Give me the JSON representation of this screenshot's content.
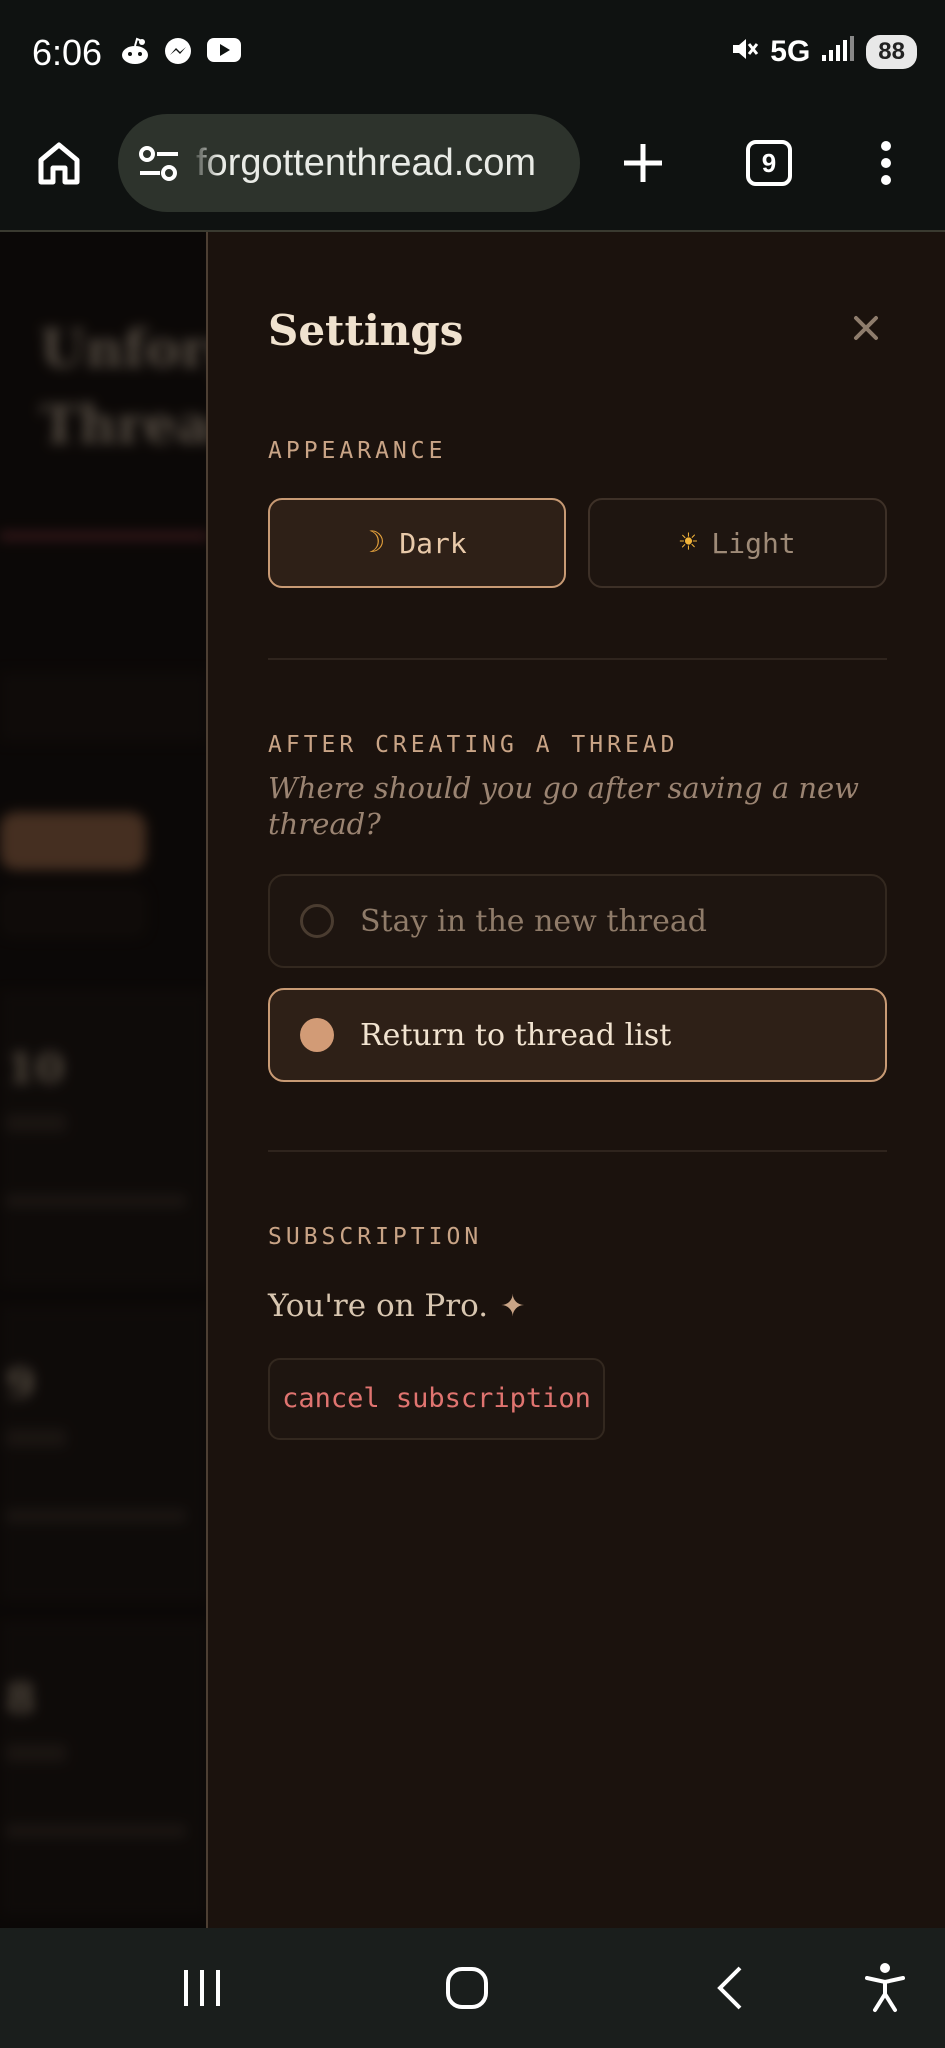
{
  "status_bar": {
    "time": "6:06",
    "network": "5G",
    "battery": "88"
  },
  "browser": {
    "url": "forgottenthread.com",
    "tab_count": "9"
  },
  "background_page": {
    "title_line1": "Unforg",
    "title_line2": "Thread",
    "cards": [
      "10",
      "9",
      "8"
    ]
  },
  "settings": {
    "title": "Settings",
    "appearance": {
      "label": "APPEARANCE",
      "dark_icon": "☽",
      "dark_label": "Dark",
      "light_icon": "☀",
      "light_label": "Light",
      "selected": "Dark"
    },
    "after_creating": {
      "label": "AFTER CREATING A THREAD",
      "question": "Where should you go after saving a new thread?",
      "options": [
        "Stay in the new thread",
        "Return to thread list"
      ],
      "selected": "Return to thread list"
    },
    "subscription": {
      "label": "SUBSCRIPTION",
      "status": "You're on Pro.",
      "sparkle": "✦",
      "cancel_label": "cancel subscription"
    }
  },
  "colors": {
    "accent": "#c89a74",
    "panel_bg": "#1b120d",
    "danger": "#e07470"
  }
}
